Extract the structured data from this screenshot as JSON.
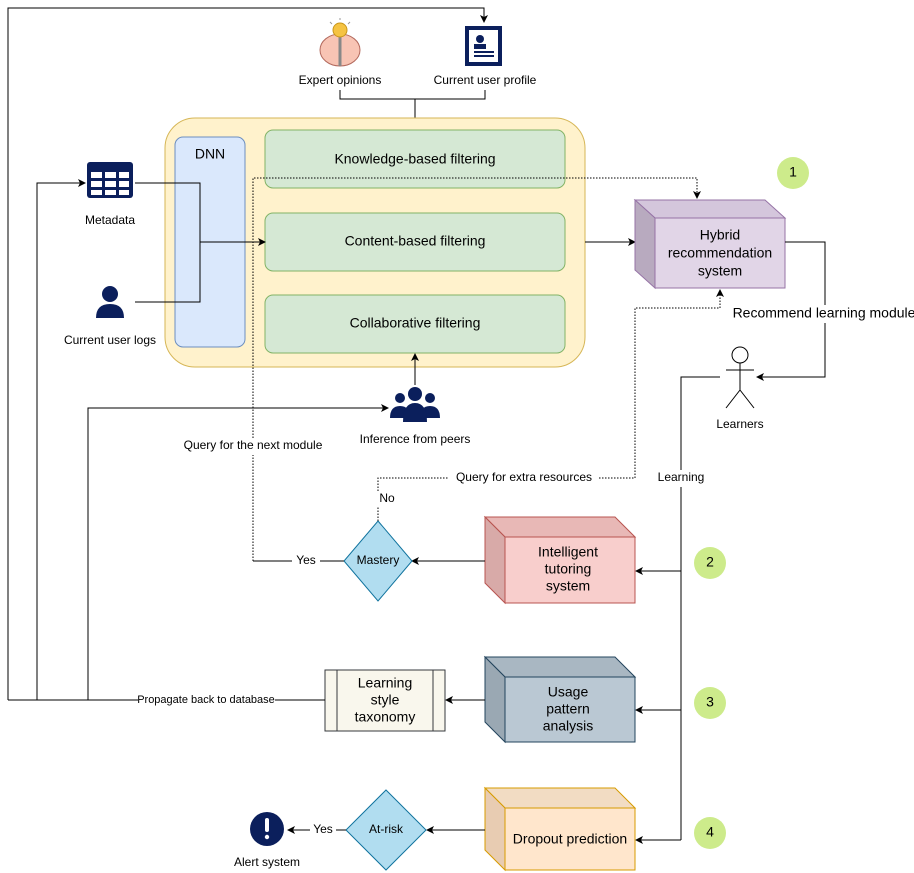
{
  "colors": {
    "container": "#fff2cc",
    "dnn": "#dae8fc",
    "filter": "#d5e8d4",
    "hybrid": "#e1d5e7",
    "tutoring": "#f8cecc",
    "usage": "#bac8d3",
    "dropout": "#ffe6cc",
    "decision": "#b1ddf0",
    "badge": "#cdeb8b",
    "icon_navy": "#0b1f5c",
    "taxonomy": "#f9f7ed"
  },
  "inputs": {
    "expert_opinions": "Expert opinions",
    "current_user_profile": "Current user profile",
    "metadata": "Metadata",
    "current_user_logs": "Current user logs",
    "inference_from_peers": "Inference from peers"
  },
  "engine": {
    "dnn": "DNN",
    "knowledge": "Knowledge-based filtering",
    "content": "Content-based filtering",
    "collaborative": "Collaborative filtering"
  },
  "hybrid": [
    "Hybrid",
    "recommendation",
    "system"
  ],
  "learners": "Learners",
  "edges": {
    "recommend": "Recommend learning module",
    "learning": "Learning",
    "query_next": "Query for the next module",
    "query_extra": "Query for extra resources",
    "no": "No",
    "yes": "Yes",
    "yes2": "Yes",
    "propagate": "Propagate back to database"
  },
  "tutoring": [
    "Intelligent",
    "tutoring",
    "system"
  ],
  "mastery": "Mastery",
  "usage": [
    "Usage",
    "pattern",
    "analysis"
  ],
  "taxonomy": [
    "Learning",
    "style",
    "taxonomy"
  ],
  "dropout": "Dropout prediction",
  "at_risk": "At-risk",
  "alert": "Alert system",
  "badges": [
    "1",
    "2",
    "3",
    "4"
  ]
}
